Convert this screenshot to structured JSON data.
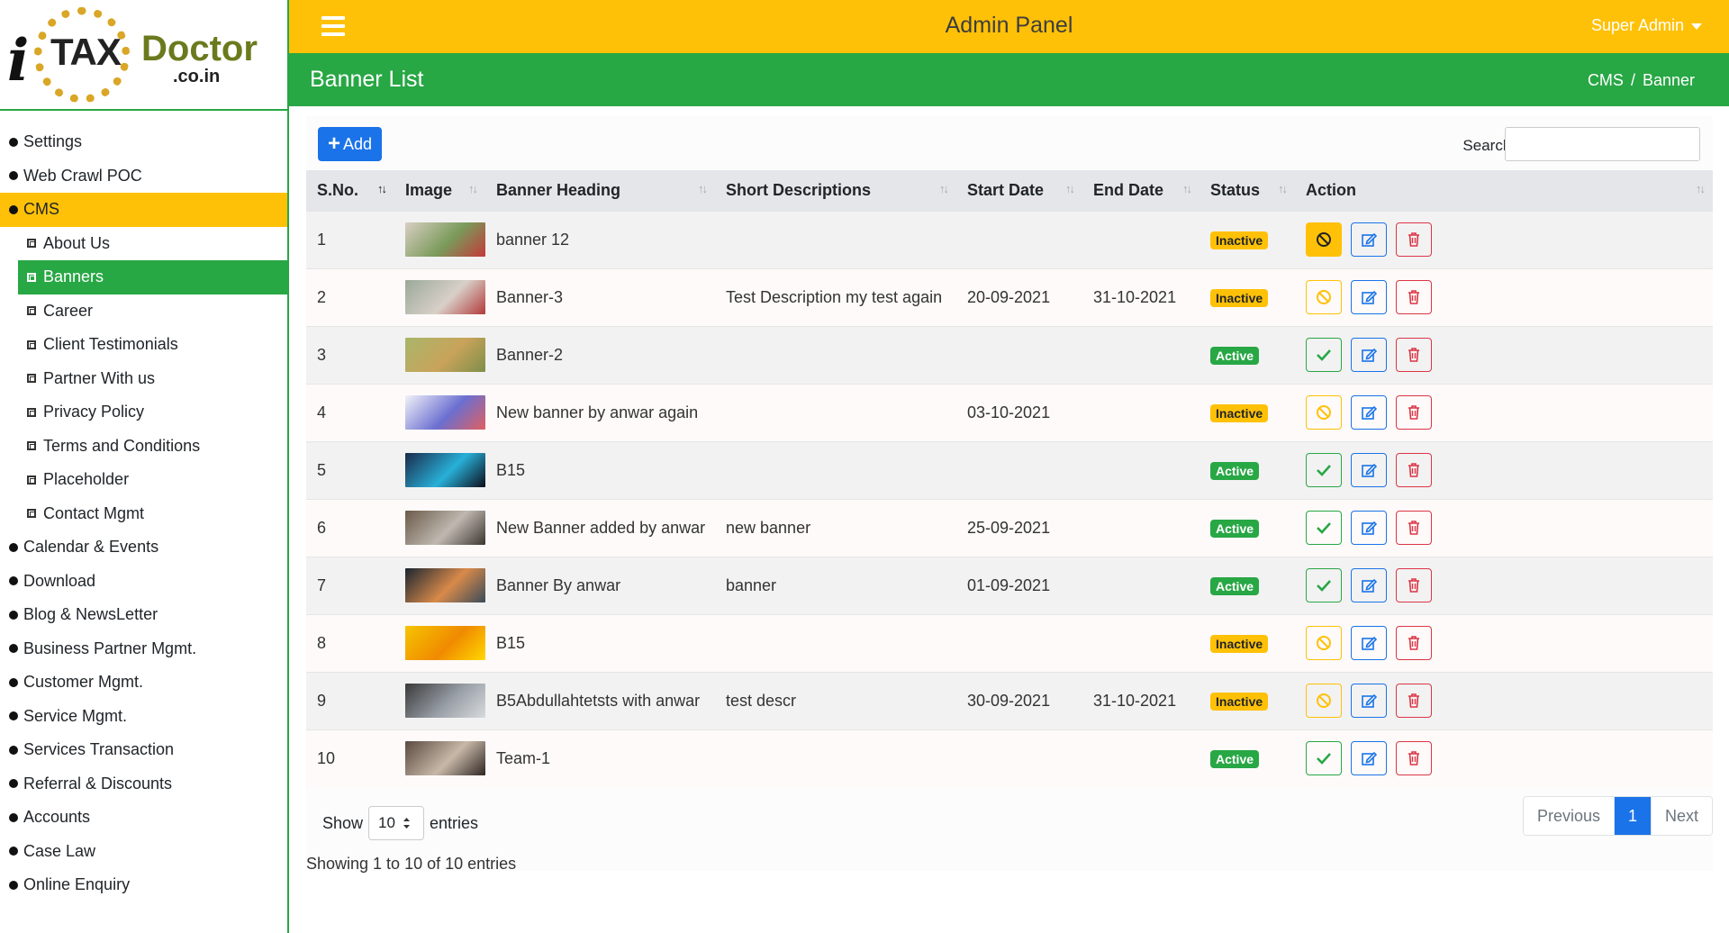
{
  "logo": {
    "i": "i",
    "tax": "TAX",
    "doctor": "Doctor",
    "domain": ".co.in"
  },
  "topbar": {
    "title": "Admin Panel",
    "user": "Super Admin"
  },
  "page": {
    "title": "Banner List",
    "breadcrumb": [
      "CMS",
      "Banner"
    ]
  },
  "sidebar": [
    {
      "label": "Settings",
      "type": "main"
    },
    {
      "label": "Web Crawl POC",
      "type": "main"
    },
    {
      "label": "CMS",
      "type": "main",
      "active": true
    },
    {
      "label": "About Us",
      "type": "sub"
    },
    {
      "label": "Banners",
      "type": "sub",
      "active": true
    },
    {
      "label": "Career",
      "type": "sub"
    },
    {
      "label": "Client Testimonials",
      "type": "sub"
    },
    {
      "label": "Partner With us",
      "type": "sub"
    },
    {
      "label": "Privacy Policy",
      "type": "sub"
    },
    {
      "label": "Terms and Conditions",
      "type": "sub"
    },
    {
      "label": "Placeholder",
      "type": "sub"
    },
    {
      "label": "Contact Mgmt",
      "type": "sub"
    },
    {
      "label": "Calendar & Events",
      "type": "main"
    },
    {
      "label": "Download",
      "type": "main"
    },
    {
      "label": "Blog & NewsLetter",
      "type": "main"
    },
    {
      "label": "Business Partner Mgmt.",
      "type": "main"
    },
    {
      "label": "Customer Mgmt.",
      "type": "main"
    },
    {
      "label": "Service Mgmt.",
      "type": "main"
    },
    {
      "label": "Services Transaction",
      "type": "main"
    },
    {
      "label": "Referral & Discounts",
      "type": "main"
    },
    {
      "label": "Accounts",
      "type": "main"
    },
    {
      "label": "Case Law",
      "type": "main"
    },
    {
      "label": "Online Enquiry",
      "type": "main"
    }
  ],
  "toolbar": {
    "add_label": "Add",
    "search_label": "Search:"
  },
  "table": {
    "columns": [
      "S.No.",
      "Image",
      "Banner Heading",
      "Short Descriptions",
      "Start Date",
      "End Date",
      "Status",
      "Action"
    ],
    "rows": [
      {
        "sno": "1",
        "thumb": [
          "#d8cfc2",
          "#7a9a5a",
          "#c43a3a"
        ],
        "heading": "banner 12",
        "desc": "",
        "start": "",
        "end": "",
        "status": "Inactive",
        "toggle_filled": true
      },
      {
        "sno": "2",
        "thumb": [
          "#9aa89a",
          "#d8d0c8",
          "#b23a3a"
        ],
        "heading": "Banner-3",
        "desc": "Test Description my test again",
        "start": "20-09-2021",
        "end": "31-10-2021",
        "status": "Inactive",
        "toggle_filled": false
      },
      {
        "sno": "3",
        "thumb": [
          "#a8b66a",
          "#c9a35a",
          "#7d8e4a"
        ],
        "heading": "Banner-2",
        "desc": "",
        "start": "",
        "end": "",
        "status": "Active",
        "toggle_filled": false
      },
      {
        "sno": "4",
        "thumb": [
          "#f2f2f8",
          "#6b6fd0",
          "#e06060"
        ],
        "heading": "New banner by anwar again",
        "desc": "",
        "start": "03-10-2021",
        "end": "",
        "status": "Inactive",
        "toggle_filled": false
      },
      {
        "sno": "5",
        "thumb": [
          "#1b2a4a",
          "#28b0d8",
          "#0d0d1a"
        ],
        "heading": "B15",
        "desc": "",
        "start": "",
        "end": "",
        "status": "Active",
        "toggle_filled": false
      },
      {
        "sno": "6",
        "thumb": [
          "#6b5a4a",
          "#bfb8b0",
          "#3d3530"
        ],
        "heading": "New Banner added by anwar",
        "desc": "new banner",
        "start": "25-09-2021",
        "end": "",
        "status": "Active",
        "toggle_filled": false
      },
      {
        "sno": "7",
        "thumb": [
          "#1a2530",
          "#d88a4a",
          "#3a4a5a"
        ],
        "heading": "Banner By anwar",
        "desc": "banner",
        "start": "01-09-2021",
        "end": "",
        "status": "Active",
        "toggle_filled": false
      },
      {
        "sno": "8",
        "thumb": [
          "#f5c400",
          "#f08a00",
          "#ffd800"
        ],
        "heading": "B15",
        "desc": "",
        "start": "",
        "end": "",
        "status": "Inactive",
        "toggle_filled": false
      },
      {
        "sno": "9",
        "thumb": [
          "#3a3a3a",
          "#9aa0a8",
          "#d8dadc"
        ],
        "heading": "B5Abdullahtetsts with anwar",
        "desc": "test descr",
        "start": "30-09-2021",
        "end": "31-10-2021",
        "status": "Inactive",
        "toggle_filled": false
      },
      {
        "sno": "10",
        "thumb": [
          "#5a4a40",
          "#c8b8a8",
          "#2e2622"
        ],
        "heading": "Team-1",
        "desc": "",
        "start": "",
        "end": "",
        "status": "Active",
        "toggle_filled": false
      }
    ]
  },
  "footer": {
    "show_label": "Show",
    "length": "10",
    "entries_label": "entries",
    "info": "Showing 1 to 10 of 10 entries",
    "pagination": {
      "previous": "Previous",
      "current": "1",
      "next": "Next"
    }
  },
  "colors": {
    "yellow": "#ffc107",
    "green": "#28a745",
    "blue": "#1a73e8",
    "red": "#dc3545"
  }
}
